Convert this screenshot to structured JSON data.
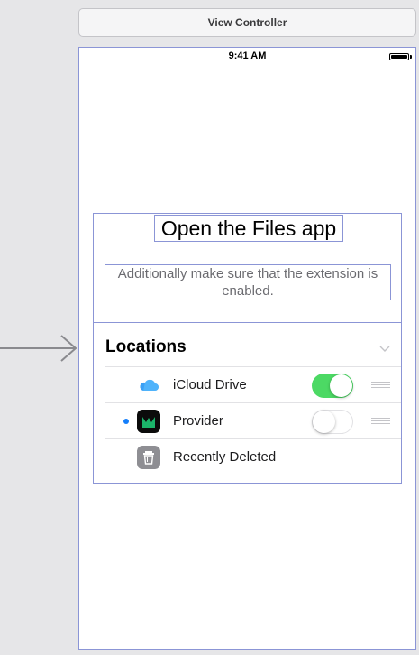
{
  "scene": {
    "header_title": "View Controller"
  },
  "status_bar": {
    "time": "9:41 AM"
  },
  "content": {
    "title": "Open the Files app",
    "subtitle": "Additionally make sure that the extension is enabled."
  },
  "locations": {
    "header": "Locations",
    "items": [
      {
        "label": "iCloud Drive",
        "icon": "icloud-icon",
        "toggle": true,
        "active_dot": false
      },
      {
        "label": "Provider",
        "icon": "provider-app-icon",
        "toggle": false,
        "active_dot": true
      },
      {
        "label": "Recently Deleted",
        "icon": "trash-icon",
        "toggle": null,
        "active_dot": false
      }
    ]
  },
  "colors": {
    "selection_outline": "#8b95d6",
    "toggle_on": "#4cd964",
    "active_dot": "#147efb"
  }
}
